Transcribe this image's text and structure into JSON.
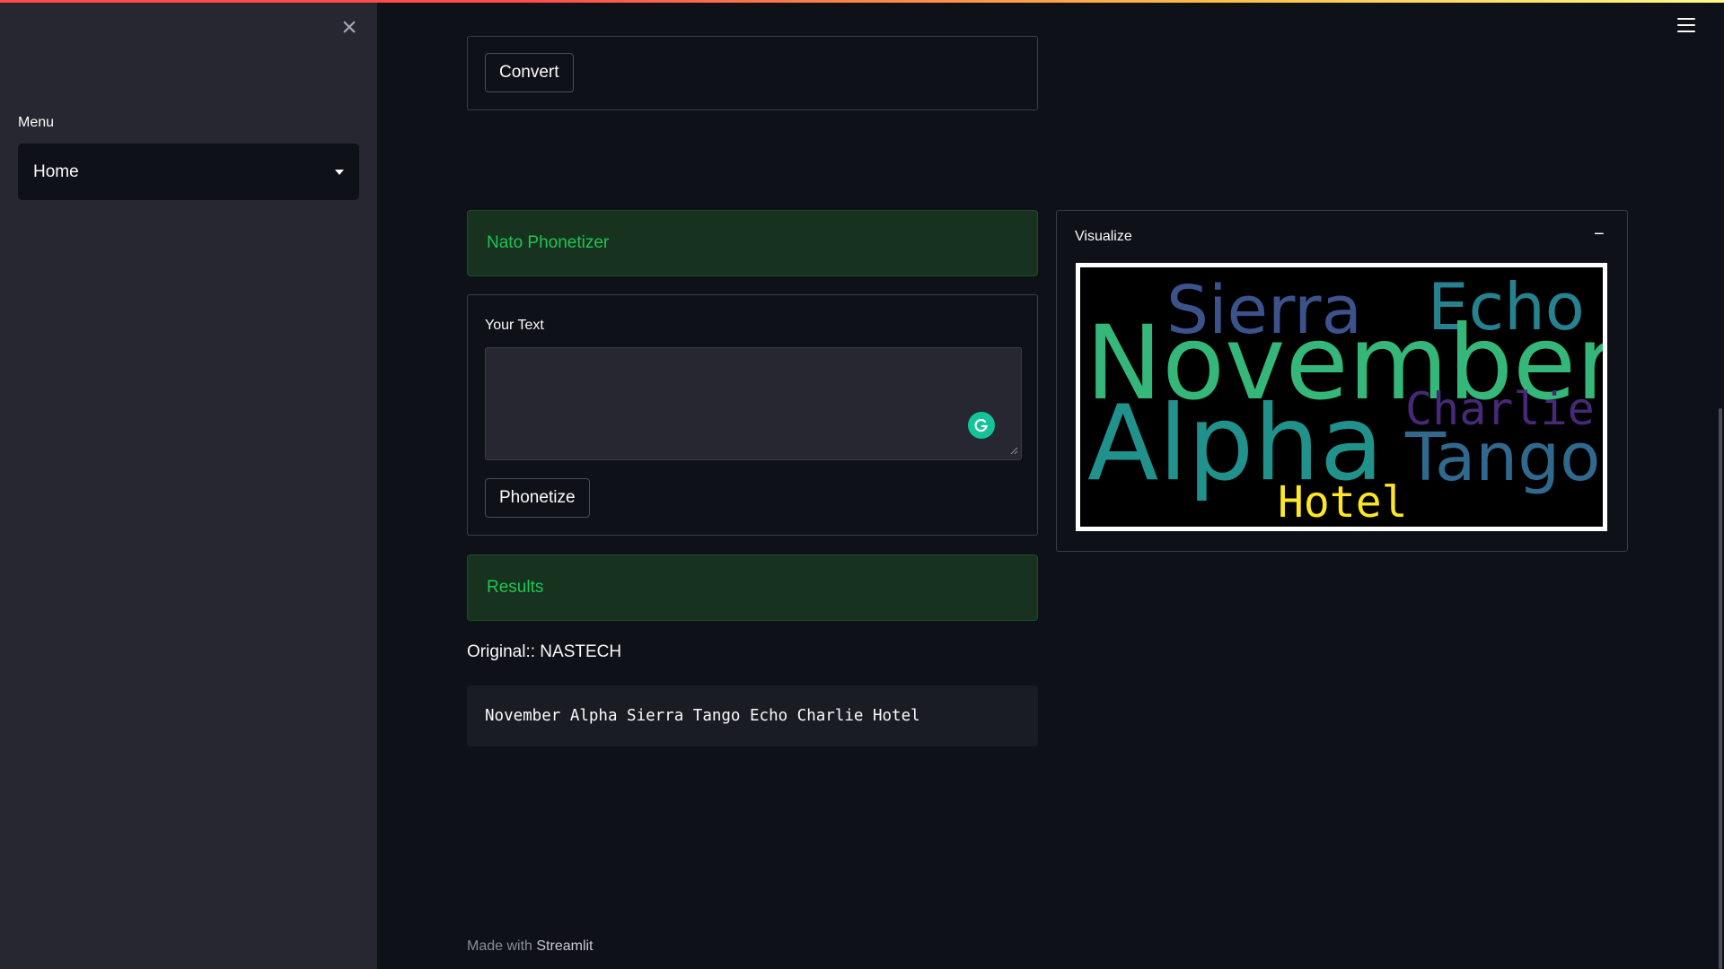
{
  "sidebar": {
    "menu_label": "Menu",
    "select_value": "Home"
  },
  "top_form": {
    "convert_label": "Convert"
  },
  "phonetizer": {
    "header": "Nato Phonetizer",
    "text_label": "Your Text",
    "text_value": "",
    "phonetize_label": "Phonetize"
  },
  "results": {
    "header": "Results",
    "original": "Original:: NASTECH",
    "phonetic": "November Alpha Sierra Tango Echo Charlie Hotel"
  },
  "visualize": {
    "title": "Visualize",
    "toggle": "−",
    "words": [
      "November",
      "Alpha",
      "Sierra",
      "Echo",
      "Tango",
      "Charlie",
      "Hotel"
    ],
    "colors": {
      "November": "#35b779",
      "Alpha": "#21918c",
      "Sierra": "#3b528b",
      "Echo": "#26828e",
      "Tango": "#31688e",
      "Charlie": "#482878",
      "Hotel": "#fde725"
    }
  },
  "footer": {
    "prefix": "Made with",
    "link": "Streamlit"
  },
  "icons": {
    "close": "close-icon",
    "menu": "hamburger-menu-icon",
    "caret": "chevron-down-icon",
    "grammarly": "grammarly-icon"
  }
}
